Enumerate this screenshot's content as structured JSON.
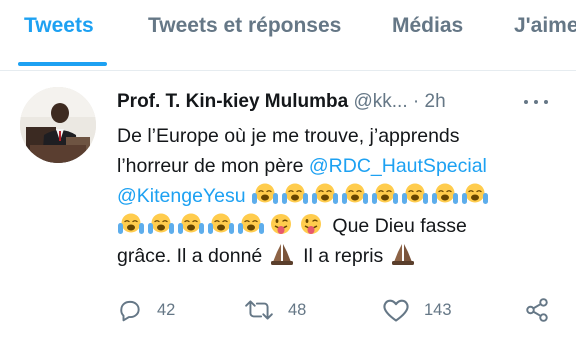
{
  "tabs": [
    {
      "label": "Tweets",
      "active": true
    },
    {
      "label": "Tweets et réponses",
      "active": false
    },
    {
      "label": "Médias",
      "active": false
    },
    {
      "label": "J'aime",
      "active": false
    }
  ],
  "tweet": {
    "author_name": "Prof. T. Kin-kiey Mulumba",
    "handle": "@kk...",
    "separator": "·",
    "time": "2h",
    "text_line1": "De l’Europe où je me trouve, j’apprends",
    "text_line2_a": "l’horreur de mon père ",
    "mention1": "@RDC_HautSpecial",
    "mention2": "@KitengeYesu",
    "text_line4": " Que Dieu fasse",
    "text_line5_a": "grâce. Il a donné ",
    "text_line5_b": " Il a repris ",
    "emoji_crying": "loudly-crying-face-emoji",
    "emoji_tongue": "winking-tongue-face-emoji",
    "emoji_pray": "folded-hands-emoji",
    "replies": "42",
    "retweets": "48",
    "likes": "143"
  },
  "colors": {
    "accent": "#1da1f2",
    "secondary_text": "#657786",
    "divider": "#e6ecf0"
  }
}
